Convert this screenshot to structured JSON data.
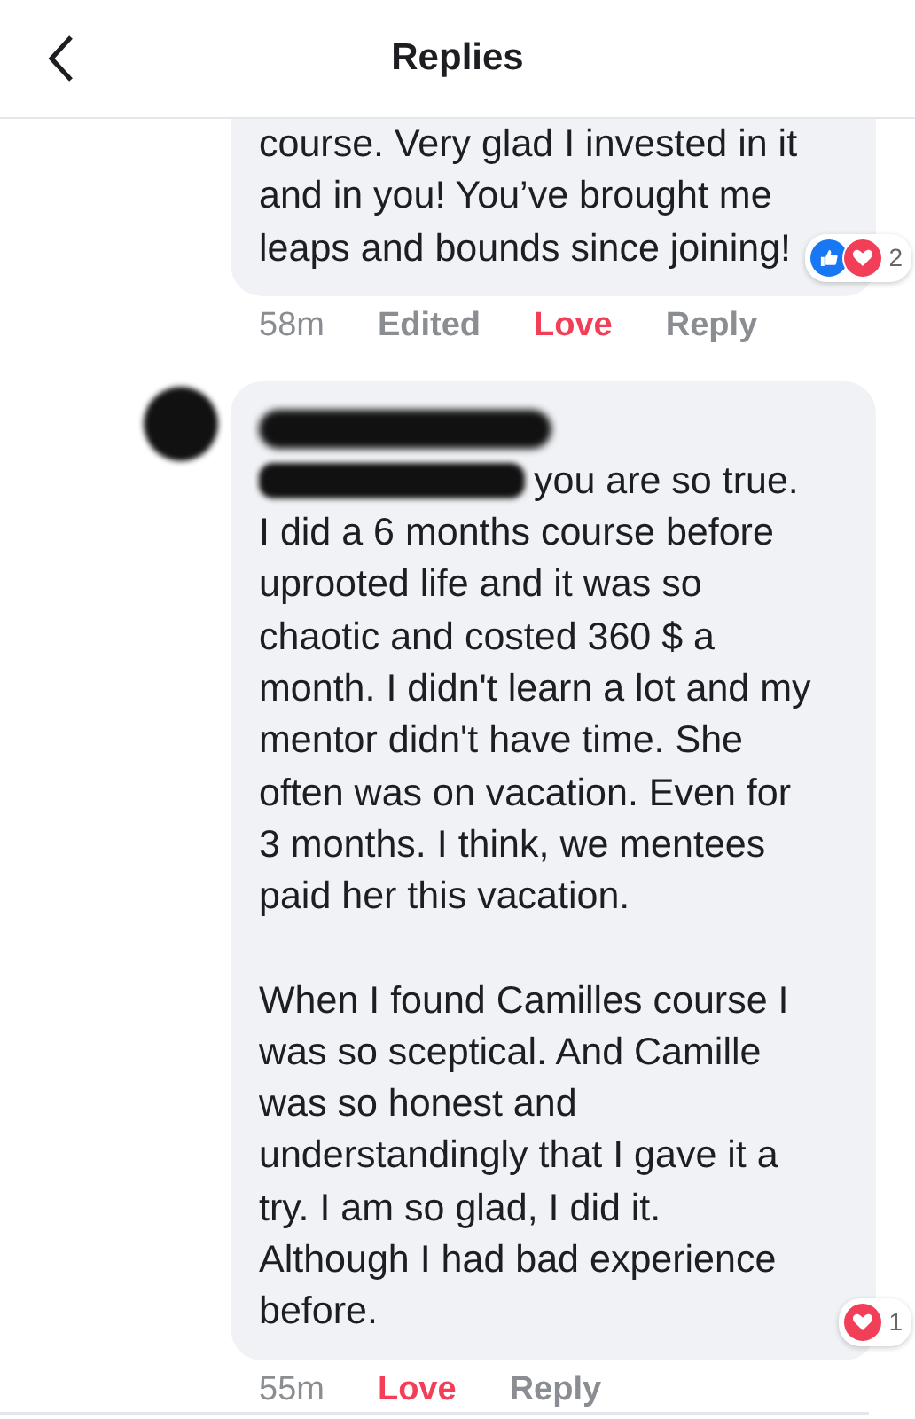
{
  "header": {
    "title": "Replies"
  },
  "comments": [
    {
      "redacted": false,
      "paragraphs": [
        "course. Very glad I invested in it and in you! You’ve brought me leaps and bounds since joining!"
      ],
      "reactions": [
        {
          "kind": "like"
        },
        {
          "kind": "love"
        }
      ],
      "reaction_count": "2",
      "time": "58m",
      "edited": "Edited",
      "love": {
        "label": "Love",
        "selected": true
      },
      "reply": "Reply"
    },
    {
      "redacted": true,
      "paragraphs": [
        "you are so true. I did a 6 months course before uprooted life and it was so chaotic and costed 360 $ a month. I didn't learn a lot and my mentor didn't have time. She often was on vacation. Even for 3 months. I think, we mentees paid her this vacation.",
        "When I found Camilles course I was so sceptical. And Camille was so honest and understandingly that I gave it a try. I am so glad, I did it. Although I had bad experience before."
      ],
      "reactions": [
        {
          "kind": "love"
        }
      ],
      "reaction_count": "1",
      "time": "55m",
      "love": {
        "label": "Love",
        "selected": true
      },
      "reply": "Reply"
    }
  ]
}
